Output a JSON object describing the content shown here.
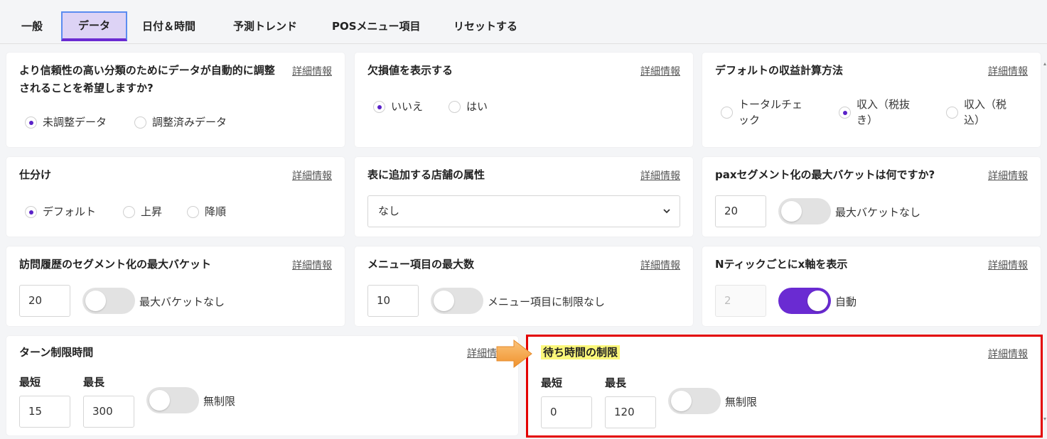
{
  "tabs": [
    {
      "label": "一般"
    },
    {
      "label": "データ"
    },
    {
      "label": "日付＆時間"
    },
    {
      "label": "予測トレンド"
    },
    {
      "label": "POSメニュー項目"
    },
    {
      "label": "リセットする"
    }
  ],
  "active_tab": "データ",
  "more_info_label": "詳細情報",
  "cards": {
    "auto_adjust": {
      "title": "より信頼性の高い分類のためにデータが自動的に調整されることを希望しますか?",
      "options": [
        {
          "label": "未調整データ",
          "selected": true
        },
        {
          "label": "調整済みデータ",
          "selected": false
        }
      ]
    },
    "missing_values": {
      "title": "欠損値を表示する",
      "options": [
        {
          "label": "いいえ",
          "selected": true
        },
        {
          "label": "はい",
          "selected": false
        }
      ]
    },
    "revenue_method": {
      "title": "デフォルトの収益計算方法",
      "options": [
        {
          "label": "トータルチェック",
          "selected": false
        },
        {
          "label": "収入（税抜き）",
          "selected": true
        },
        {
          "label": "収入（税込）",
          "selected": false
        }
      ]
    },
    "sorting": {
      "title": "仕分け",
      "options": [
        {
          "label": "デフォルト",
          "selected": true
        },
        {
          "label": "上昇",
          "selected": false
        },
        {
          "label": "降順",
          "selected": false
        }
      ]
    },
    "store_attribute": {
      "title": "表に追加する店舗の属性",
      "selected": "なし"
    },
    "pax_segment": {
      "title": "paxセグメント化の最大バケットは何ですか?",
      "value": "20",
      "toggle_label": "最大バケットなし",
      "toggle_on": false
    },
    "visit_history": {
      "title": "訪問履歴のセグメント化の最大バケット",
      "value": "20",
      "toggle_label": "最大バケットなし",
      "toggle_on": false
    },
    "menu_items": {
      "title": "メニュー項目の最大数",
      "value": "10",
      "toggle_label": "メニュー項目に制限なし",
      "toggle_on": false
    },
    "x_axis": {
      "title": "Nティックごとにx軸を表示",
      "value": "2",
      "toggle_label": "自動",
      "toggle_on": true
    },
    "turn_time": {
      "title": "ターン制限時間",
      "min_label": "最短",
      "max_label": "最長",
      "min_value": "15",
      "max_value": "300",
      "toggle_label": "無制限",
      "toggle_on": false,
      "more_info_partial": "詳細情"
    },
    "wait_time": {
      "title": "待ち時間の制限",
      "min_label": "最短",
      "max_label": "最長",
      "min_value": "0",
      "max_value": "120",
      "toggle_label": "無制限",
      "toggle_on": false
    }
  },
  "colors": {
    "accent": "#6a2bd2",
    "highlight_frame": "#e30000",
    "arrow": "#f5a040",
    "text_highlight": "#fbf77a"
  }
}
